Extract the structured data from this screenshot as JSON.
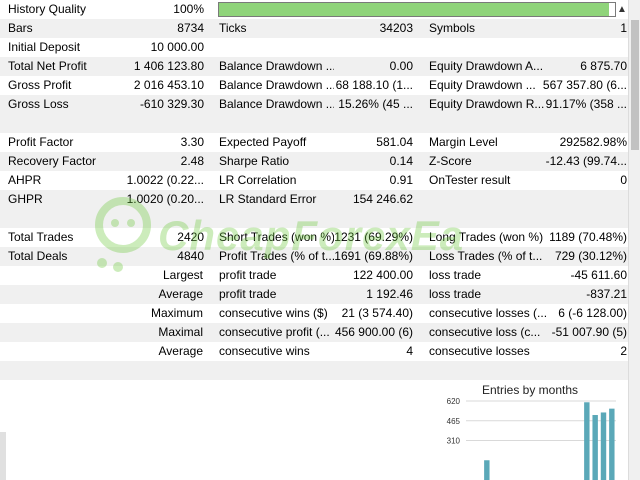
{
  "history_quality": {
    "label": "History Quality",
    "value": "100%",
    "progress_fraction": 0.985
  },
  "rows1": [
    {
      "c1l": "Bars",
      "c1v": "8734",
      "c2l": "Ticks",
      "c2v": "34203",
      "c3l": "Symbols",
      "c3v": "1"
    },
    {
      "c1l": "Initial Deposit",
      "c1v": "10 000.00",
      "c2l": "",
      "c2v": "",
      "c3l": "",
      "c3v": ""
    },
    {
      "c1l": "Total Net Profit",
      "c1v": "1 406 123.80",
      "c2l": "Balance Drawdown ...",
      "c2v": "0.00",
      "c3l": "Equity Drawdown A...",
      "c3v": "6 875.70"
    },
    {
      "c1l": "Gross Profit",
      "c1v": "2 016 453.10",
      "c2l": "Balance Drawdown ...",
      "c2v": "68 188.10 (1...",
      "c3l": "Equity Drawdown ...",
      "c3v": "567 357.80 (6..."
    },
    {
      "c1l": "Gross Loss",
      "c1v": "-610 329.30",
      "c2l": "Balance Drawdown ...",
      "c2v": "15.26% (45 ...",
      "c3l": "Equity Drawdown R...",
      "c3v": "91.17% (358 ..."
    }
  ],
  "rows2": [
    {
      "c1l": "Profit Factor",
      "c1v": "3.30",
      "c2l": "Expected Payoff",
      "c2v": "581.04",
      "c3l": "Margin Level",
      "c3v": "292582.98%"
    },
    {
      "c1l": "Recovery Factor",
      "c1v": "2.48",
      "c2l": "Sharpe Ratio",
      "c2v": "0.14",
      "c3l": "Z-Score",
      "c3v": "-12.43 (99.74..."
    },
    {
      "c1l": "AHPR",
      "c1v": "1.0022 (0.22...",
      "c2l": "LR Correlation",
      "c2v": "0.91",
      "c3l": "OnTester result",
      "c3v": "0"
    },
    {
      "c1l": "GHPR",
      "c1v": "1.0020 (0.20...",
      "c2l": "LR Standard Error",
      "c2v": "154 246.62",
      "c3l": "",
      "c3v": ""
    }
  ],
  "rows3": [
    {
      "c1l": "Total Trades",
      "c1v": "2420",
      "c2l": "Short Trades (won %)",
      "c2v": "1231 (69.29%)",
      "c3l": "Long Trades (won %)",
      "c3v": "1189 (70.48%)"
    },
    {
      "c1l": "Total Deals",
      "c1v": "4840",
      "c2l": "Profit Trades (% of t...",
      "c2v": "1691 (69.88%)",
      "c3l": "Loss Trades (% of t...",
      "c3v": "729 (30.12%)"
    },
    {
      "c1r": "Largest",
      "c2l": "profit trade",
      "c2v": "122 400.00",
      "c3l": "loss trade",
      "c3v": "-45 611.60"
    },
    {
      "c1r": "Average",
      "c2l": "profit trade",
      "c2v": "1 192.46",
      "c3l": "loss trade",
      "c3v": "-837.21"
    },
    {
      "c1r": "Maximum",
      "c2l": "consecutive wins ($)",
      "c2v": "21 (3 574.40)",
      "c3l": "consecutive losses (...",
      "c3v": "6 (-6 128.00)"
    },
    {
      "c1r": "Maximal",
      "c2l": "consecutive profit (...",
      "c2v": "456 900.00 (6)",
      "c3l": "consecutive loss (c...",
      "c3v": "-51 007.90 (5)"
    },
    {
      "c1r": "Average",
      "c2l": "consecutive wins",
      "c2v": "4",
      "c3l": "consecutive losses",
      "c3v": "2"
    }
  ],
  "watermark": "CheapForexEa",
  "chart_data": {
    "type": "bar",
    "title": "Entries by months",
    "yticks": [
      "620",
      "465",
      "310"
    ],
    "ylim": [
      0,
      620
    ],
    "values": [
      0,
      0,
      155,
      0,
      0,
      0,
      0,
      0,
      0,
      0,
      0,
      0,
      0,
      0,
      610,
      510,
      530,
      560
    ],
    "colors": {
      "bar": "#5aa8b8",
      "grid": "#d9d9d9"
    }
  }
}
